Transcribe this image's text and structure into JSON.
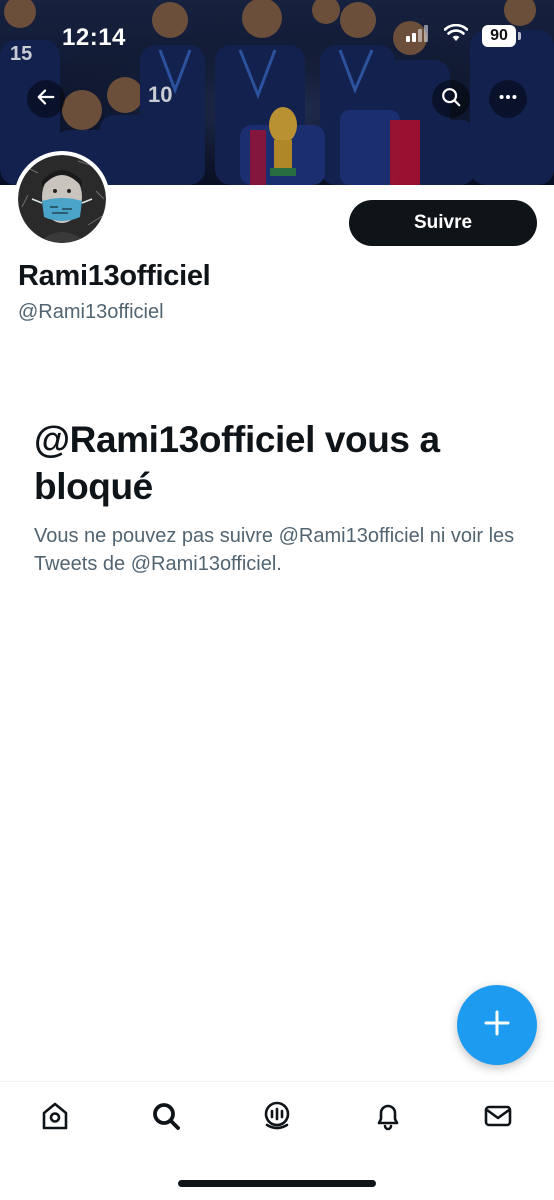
{
  "status_bar": {
    "time": "12:14",
    "battery": "90",
    "icons": [
      "cellular-signal-icon",
      "wifi-icon",
      "battery-icon"
    ]
  },
  "header": {
    "back_icon": "arrow-left-icon",
    "search_icon": "search-icon",
    "more_icon": "more-horizontal-icon"
  },
  "profile": {
    "display_name": "Rami13officiel",
    "handle": "@Rami13officiel",
    "follow_label": "Suivre"
  },
  "blocked": {
    "title": "@Rami13officiel vous a bloqué",
    "description": "Vous ne pouvez pas suivre @Rami13officiel ni voir les Tweets de @Rami13officiel."
  },
  "fab": {
    "icon": "plus-icon"
  },
  "bottom_nav": {
    "items": [
      {
        "icon": "home-icon"
      },
      {
        "icon": "search-icon"
      },
      {
        "icon": "spaces-icon"
      },
      {
        "icon": "notifications-bell-icon"
      },
      {
        "icon": "messages-envelope-icon"
      }
    ]
  },
  "colors": {
    "accent": "#1d9bf0",
    "text_primary": "#0f1419",
    "text_secondary": "#536471",
    "button_dark": "#0f1419"
  }
}
